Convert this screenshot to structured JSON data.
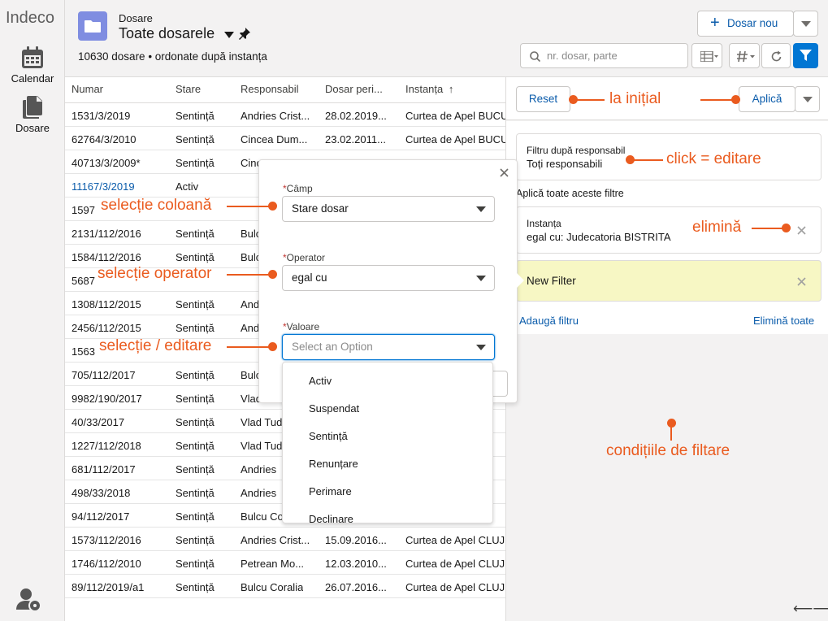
{
  "app": {
    "name": "Indeco"
  },
  "sidebar": {
    "items": [
      {
        "label": "Calendar",
        "icon": "calendar-icon"
      },
      {
        "label": "Dosare",
        "icon": "documents-icon"
      }
    ]
  },
  "header": {
    "object_label": "Dosare",
    "list_title": "Toate dosarele",
    "count_line": "10630 dosare • ordonate după instanța",
    "new_button": "Dosar nou",
    "search_placeholder": "nr. dosar, parte"
  },
  "table": {
    "columns": [
      "Numar",
      "Stare",
      "Responsabil",
      "Dosar peri...",
      "Instanța"
    ],
    "sort_indicator": "↑",
    "rows": [
      [
        "1531/3/2019",
        "Sentință",
        "Andries Crist...",
        "28.02.2019...",
        "Curtea de Apel BUCU"
      ],
      [
        "62764/3/2010",
        "Sentință",
        "Cincea Dum...",
        "23.02.2011...",
        "Curtea de Apel BUCU"
      ],
      [
        "40713/3/2009*",
        "Sentință",
        "Cinc",
        "",
        ""
      ],
      [
        "11167/3/2019",
        "Activ",
        "",
        "",
        ""
      ],
      [
        "1597",
        "",
        "",
        "",
        ""
      ],
      [
        "2131/112/2016",
        "Sentință",
        "Bulc",
        "",
        ""
      ],
      [
        "1584/112/2016",
        "Sentință",
        "Bulc",
        "",
        ""
      ],
      [
        "5687",
        "",
        "",
        "",
        ""
      ],
      [
        "1308/112/2015",
        "Sentință",
        "Andr",
        "",
        ""
      ],
      [
        "2456/112/2015",
        "Sentință",
        "Andr",
        "",
        ""
      ],
      [
        "1563",
        "",
        "",
        "",
        ""
      ],
      [
        "705/112/2017",
        "Sentință",
        "Bulc",
        "",
        ""
      ],
      [
        "9982/190/2017",
        "Sentință",
        "Vlad",
        "",
        ""
      ],
      [
        "40/33/2017",
        "Sentință",
        "Vlad Tud",
        "",
        "CLUJ"
      ],
      [
        "1227/112/2018",
        "Sentință",
        "Vlad Tud",
        "",
        "CLUJ"
      ],
      [
        "681/112/2017",
        "Sentință",
        "Andries",
        "",
        "CLUJ"
      ],
      [
        "498/33/2018",
        "Sentință",
        "Andries",
        "",
        "CLUJ"
      ],
      [
        "94/112/2017",
        "Sentință",
        "Bulcu Co",
        "",
        "CLUJ"
      ],
      [
        "1573/112/2016",
        "Sentință",
        "Andries Crist...",
        "15.09.2016...",
        "Curtea de Apel CLUJ"
      ],
      [
        "1746/112/2010",
        "Sentință",
        "Petrean Mo...",
        "12.03.2010...",
        "Curtea de Apel CLUJ"
      ],
      [
        "89/112/2019/a1",
        "Sentință",
        "Bulcu Coralia",
        "26.07.2016...",
        "Curtea de Apel CLUJ"
      ]
    ]
  },
  "filter_panel": {
    "reset": "Reset",
    "apply": "Aplică",
    "owner_filter": {
      "title": "Filtru după responsabil",
      "value": "Toți responsabili"
    },
    "apply_all_label": "Aplică toate aceste filtre",
    "filters": [
      {
        "field": "Instanța",
        "condition": "egal cu: Judecatoria BISTRITA"
      }
    ],
    "new_filter": "New Filter",
    "add_filter": "Adaugă filtru",
    "remove_all": "Elimină toate"
  },
  "popover": {
    "field_label": "Câmp",
    "field_value": "Stare dosar",
    "operator_label": "Operator",
    "operator_value": "egal cu",
    "value_label": "Valoare",
    "value_placeholder": "Select an Option",
    "required_mark": "*",
    "options": [
      "Activ",
      "Suspendat",
      "Sentință",
      "Renunțare",
      "Perimare",
      "Declinare"
    ]
  },
  "annotations": {
    "reset_note": "la inițial",
    "owner_note": "click = editare",
    "remove_note": "elimină",
    "column_note": "selecție coloană",
    "operator_note": "selecție operator",
    "value_note": "selecție / editare",
    "conditions_note": "condițiile de filtare"
  },
  "colors": {
    "accent": "#0176d3",
    "annotation": "#ea5b1f",
    "new_filter_bg": "#f7f7c4",
    "badge": "#7f8de1"
  }
}
